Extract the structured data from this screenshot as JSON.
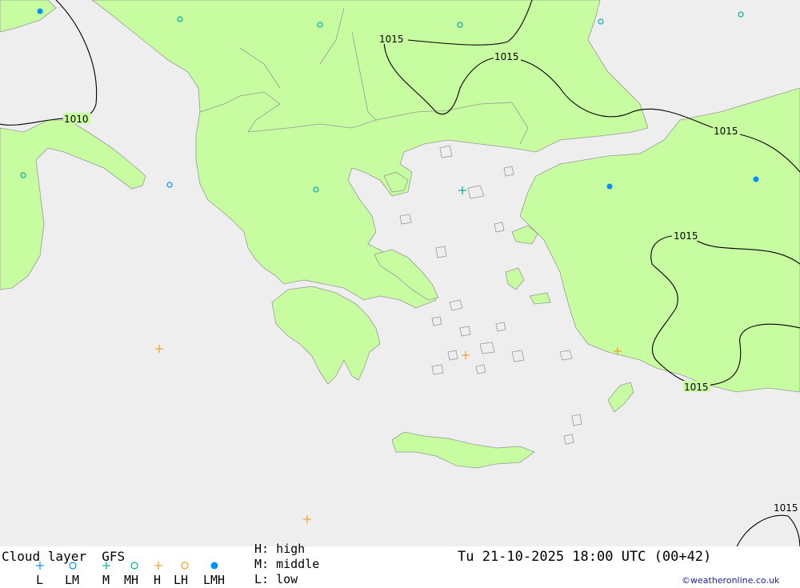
{
  "title": "Cloud layer  GFS",
  "datetime": "Tu 21-10-2025 18:00 UTC (00+42)",
  "credit": "©weatheronline.co.uk",
  "legend": {
    "items": [
      {
        "symbol": "plus",
        "color": "#0090ff",
        "label": "L"
      },
      {
        "symbol": "circle",
        "color": "#0090ff",
        "label": "LM"
      },
      {
        "symbol": "plus",
        "color": "#00b0a0",
        "label": "M"
      },
      {
        "symbol": "circle",
        "color": "#00b0a0",
        "label": "MH"
      },
      {
        "symbol": "plus",
        "color": "#f0a020",
        "label": "H"
      },
      {
        "symbol": "circle",
        "color": "#f0a020",
        "label": "LH"
      },
      {
        "symbol": "dot",
        "color": "#0090ff",
        "label": "LMH"
      }
    ],
    "key_h": "H: high",
    "key_m": "M: middle",
    "key_l": "L: low"
  },
  "colors": {
    "land": "#c8fca0",
    "sea": "#eeeeee",
    "border": "#999999",
    "isobar": "#000000"
  },
  "isobars": [
    {
      "label": "1015"
    },
    {
      "label": "1015"
    },
    {
      "label": "1010"
    },
    {
      "label": "1015"
    },
    {
      "label": "1015"
    },
    {
      "label": "1015"
    },
    {
      "label": "1015"
    }
  ]
}
